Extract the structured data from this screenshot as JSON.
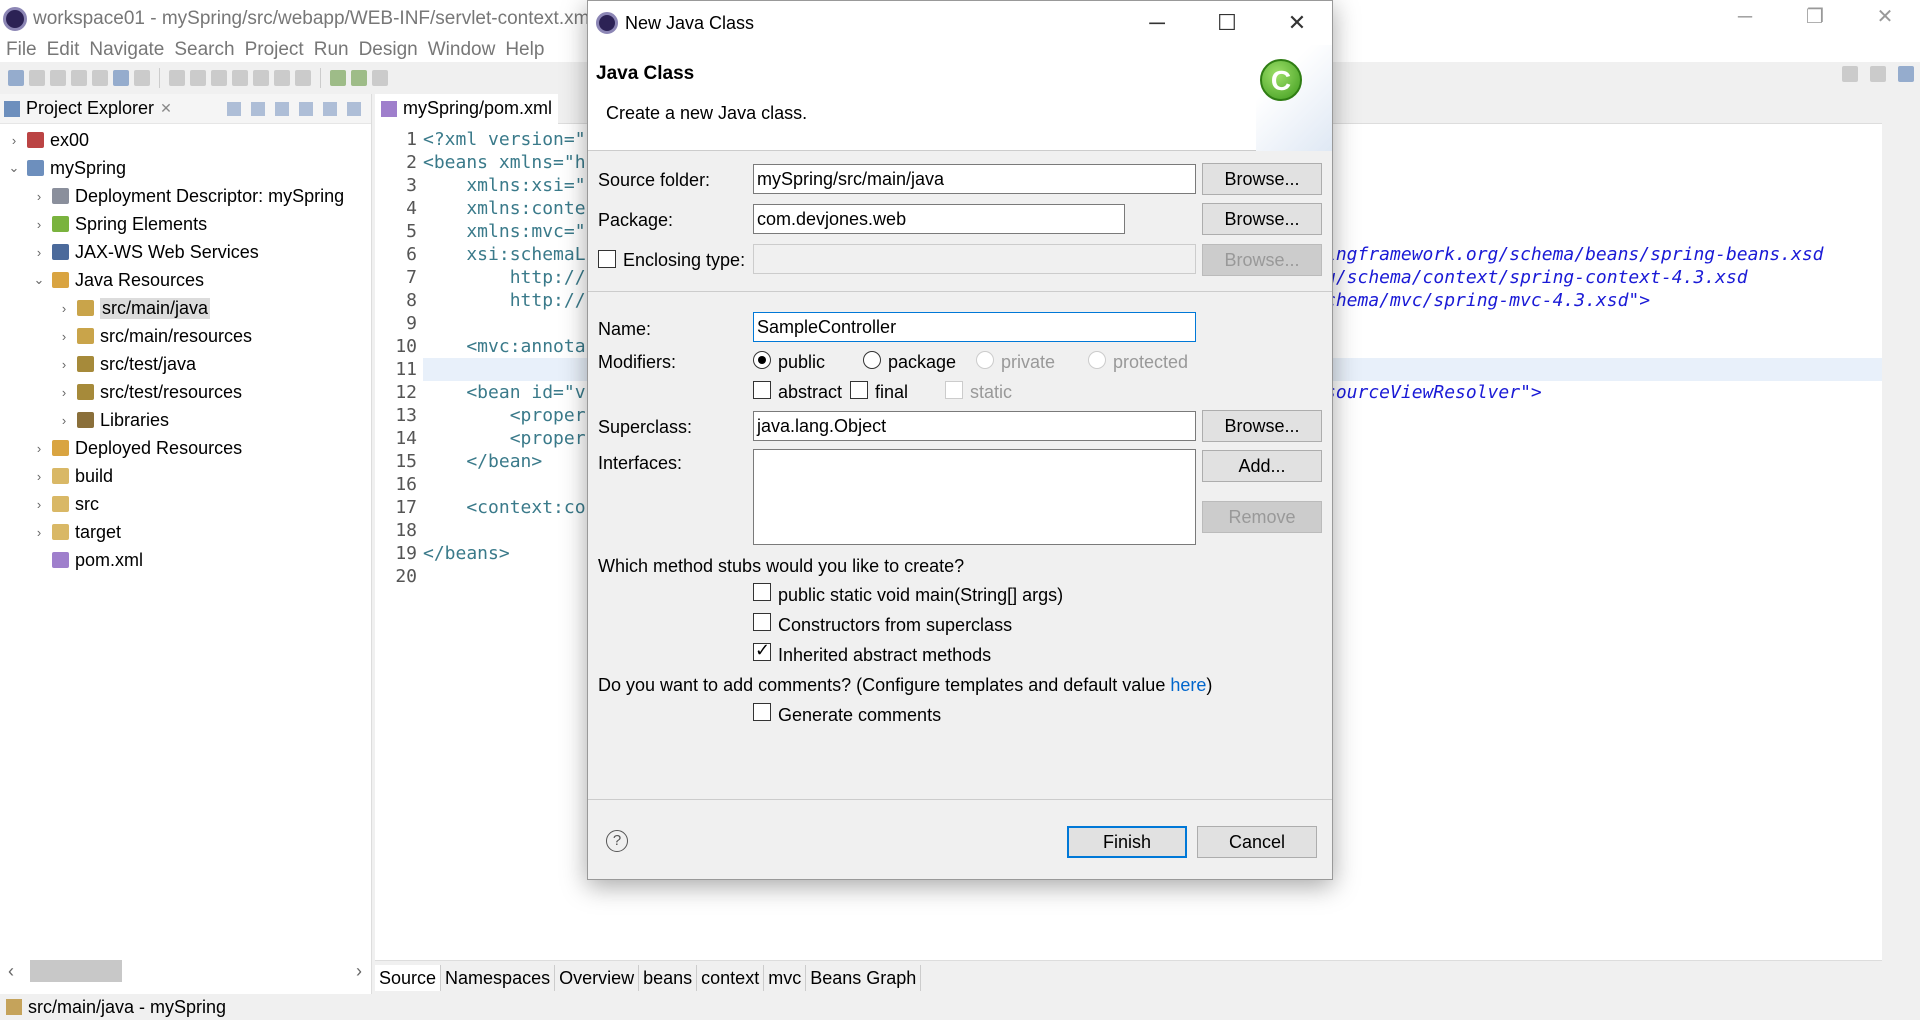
{
  "window": {
    "title": "workspace01 - mySpring/src/webapp/WEB-INF/servlet-context.xml -",
    "controls": [
      "─",
      "❐",
      "✕"
    ]
  },
  "menu": [
    "File",
    "Edit",
    "Navigate",
    "Search",
    "Project",
    "Run",
    "Design",
    "Window",
    "Help"
  ],
  "explorer": {
    "title": "Project Explorer",
    "close": "✕",
    "tree": [
      {
        "label": "ex00",
        "chev": "›",
        "depth": 0,
        "icon": "project-icon",
        "color": "#b44"
      },
      {
        "label": "mySpring",
        "chev": "⌄",
        "depth": 0,
        "icon": "spring-project-icon",
        "color": "#6d8fbd"
      },
      {
        "label": "Deployment Descriptor: mySpring",
        "chev": "›",
        "depth": 1,
        "icon": "descriptor-icon",
        "color": "#8a8f9c"
      },
      {
        "label": "Spring Elements",
        "chev": "›",
        "depth": 1,
        "icon": "spring-leaf-icon",
        "color": "#7ab33e"
      },
      {
        "label": "JAX-WS Web Services",
        "chev": "›",
        "depth": 1,
        "icon": "webservice-icon",
        "color": "#4b6a9b"
      },
      {
        "label": "Java Resources",
        "chev": "⌄",
        "depth": 1,
        "icon": "java-resources-icon",
        "color": "#d9a441"
      },
      {
        "label": "src/main/java",
        "chev": "›",
        "depth": 2,
        "icon": "package-folder-icon",
        "color": "#c9a44a",
        "selected": true
      },
      {
        "label": "src/main/resources",
        "chev": "›",
        "depth": 2,
        "icon": "package-folder-icon",
        "color": "#c9a44a"
      },
      {
        "label": "src/test/java",
        "chev": "›",
        "depth": 2,
        "icon": "package-folder-icon",
        "color": "#a68a3a"
      },
      {
        "label": "src/test/resources",
        "chev": "›",
        "depth": 2,
        "icon": "package-folder-icon",
        "color": "#a68a3a"
      },
      {
        "label": "Libraries",
        "chev": "›",
        "depth": 2,
        "icon": "library-icon",
        "color": "#8a6f3a"
      },
      {
        "label": "Deployed Resources",
        "chev": "›",
        "depth": 1,
        "icon": "deployed-icon",
        "color": "#d9a441"
      },
      {
        "label": "build",
        "chev": "›",
        "depth": 1,
        "icon": "folder-icon",
        "color": "#d9b866"
      },
      {
        "label": "src",
        "chev": "›",
        "depth": 1,
        "icon": "folder-icon",
        "color": "#d9b866"
      },
      {
        "label": "target",
        "chev": "›",
        "depth": 1,
        "icon": "folder-icon",
        "color": "#d9b866"
      },
      {
        "label": "pom.xml",
        "chev": "",
        "depth": 1,
        "icon": "maven-file-icon",
        "color": "#9f7fcc"
      }
    ]
  },
  "editor": {
    "tab": "mySpring/pom.xml",
    "line_numbers": [
      "1",
      "2",
      "3",
      "4",
      "5",
      "6",
      "7",
      "8",
      "9",
      "10",
      "11",
      "12",
      "13",
      "14",
      "15",
      "16",
      "17",
      "18",
      "19",
      "20"
    ],
    "lines": [
      "<?xml version=\"",
      "<beans xmlns=\"h",
      "    xmlns:xsi=\"",
      "    xmlns:conte",
      "    xmlns:mvc=\"",
      "    xsi:schemaL",
      "        http://",
      "        http://",
      "",
      "    <mvc:annota",
      "",
      "    <bean id=\"v",
      "        <proper",
      "        <proper",
      "    </bean>",
      "",
      "    <context:co",
      "",
      "</beans>",
      ""
    ],
    "right_fragments": {
      "line6": "ingframework.org/schema/beans/spring-beans.xsd",
      "line7": "g/schema/context/spring-context-4.3.xsd",
      "line8": "chema/mvc/spring-mvc-4.3.xsd\">",
      "line12": "sourceViewResolver\">"
    },
    "bottom_tabs": [
      "Source",
      "Namespaces",
      "Overview",
      "beans",
      "context",
      "mvc",
      "Beans Graph"
    ]
  },
  "status": {
    "text": "src/main/java - mySpring"
  },
  "dialog": {
    "title": "New Java Class",
    "controls": [
      "─",
      "☐",
      "✕"
    ],
    "heading": "Java Class",
    "subtitle": "Create a new Java class.",
    "wizard_glyph": "C",
    "source_folder": {
      "label": "Source folder:",
      "value": "mySpring/src/main/java",
      "browse": "Browse..."
    },
    "package": {
      "label": "Package:",
      "value": "com.devjones.web",
      "browse": "Browse..."
    },
    "enclosing": {
      "label": "Enclosing type:",
      "value": "",
      "browse": "Browse..."
    },
    "name": {
      "label": "Name:",
      "value": "SampleController"
    },
    "modifiers": {
      "label": "Modifiers:",
      "access": [
        "public",
        "package",
        "private",
        "protected"
      ],
      "selected": "public",
      "flags": [
        "abstract",
        "final",
        "static"
      ]
    },
    "superclass": {
      "label": "Superclass:",
      "value": "java.lang.Object",
      "browse": "Browse..."
    },
    "interfaces": {
      "label": "Interfaces:",
      "add": "Add...",
      "remove": "Remove"
    },
    "stubs": {
      "question": "Which method stubs would you like to create?",
      "items": [
        {
          "label": "public static void main(String[] args)",
          "checked": false
        },
        {
          "label": "Constructors from superclass",
          "checked": false
        },
        {
          "label": "Inherited abstract methods",
          "checked": true
        }
      ]
    },
    "comments": {
      "question_before": "Do you want to add comments? (Configure templates and default value ",
      "link": "here",
      "question_after": ")",
      "generate": "Generate comments"
    },
    "help": "?",
    "finish": "Finish",
    "cancel": "Cancel"
  }
}
